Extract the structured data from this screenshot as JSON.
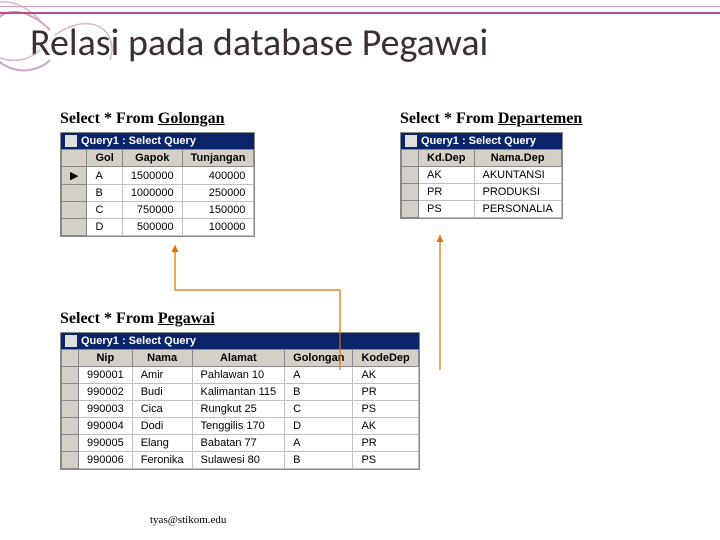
{
  "title": "Relasi pada database Pegawai",
  "labels": {
    "golongan_prefix": "Select * From ",
    "golongan_kw": "Golongan",
    "departemen_prefix": "Select * From ",
    "departemen_kw": "Departemen",
    "pegawai_prefix": "Select * From ",
    "pegawai_kw": "Pegawai"
  },
  "golongan": {
    "winTitle": "Query1 : Select Query",
    "headers": [
      "Gol",
      "Gapok",
      "Tunjangan"
    ],
    "rows": [
      [
        "A",
        "1500000",
        "400000"
      ],
      [
        "B",
        "1000000",
        "250000"
      ],
      [
        "C",
        "750000",
        "150000"
      ],
      [
        "D",
        "500000",
        "100000"
      ]
    ]
  },
  "departemen": {
    "winTitle": "Query1 : Select Query",
    "headers": [
      "Kd.Dep",
      "Nama.Dep"
    ],
    "rows": [
      [
        "AK",
        "AKUNTANSI"
      ],
      [
        "PR",
        "PRODUKSI"
      ],
      [
        "PS",
        "PERSONALIA"
      ]
    ]
  },
  "pegawai": {
    "winTitle": "Query1 : Select Query",
    "headers": [
      "Nip",
      "Nama",
      "Alamat",
      "Golongan",
      "KodeDep"
    ],
    "rows": [
      [
        "990001",
        "Amir",
        "Pahlawan 10",
        "A",
        "AK"
      ],
      [
        "990002",
        "Budi",
        "Kalimantan 115",
        "B",
        "PR"
      ],
      [
        "990003",
        "Cica",
        "Rungkut 25",
        "C",
        "PS"
      ],
      [
        "990004",
        "Dodi",
        "Tenggilis 170",
        "D",
        "AK"
      ],
      [
        "990005",
        "Elang",
        "Babatan 77",
        "A",
        "PR"
      ],
      [
        "990006",
        "Feronika",
        "Sulawesi 80",
        "B",
        "PS"
      ]
    ]
  },
  "footer": "tyas@stikom.edu"
}
